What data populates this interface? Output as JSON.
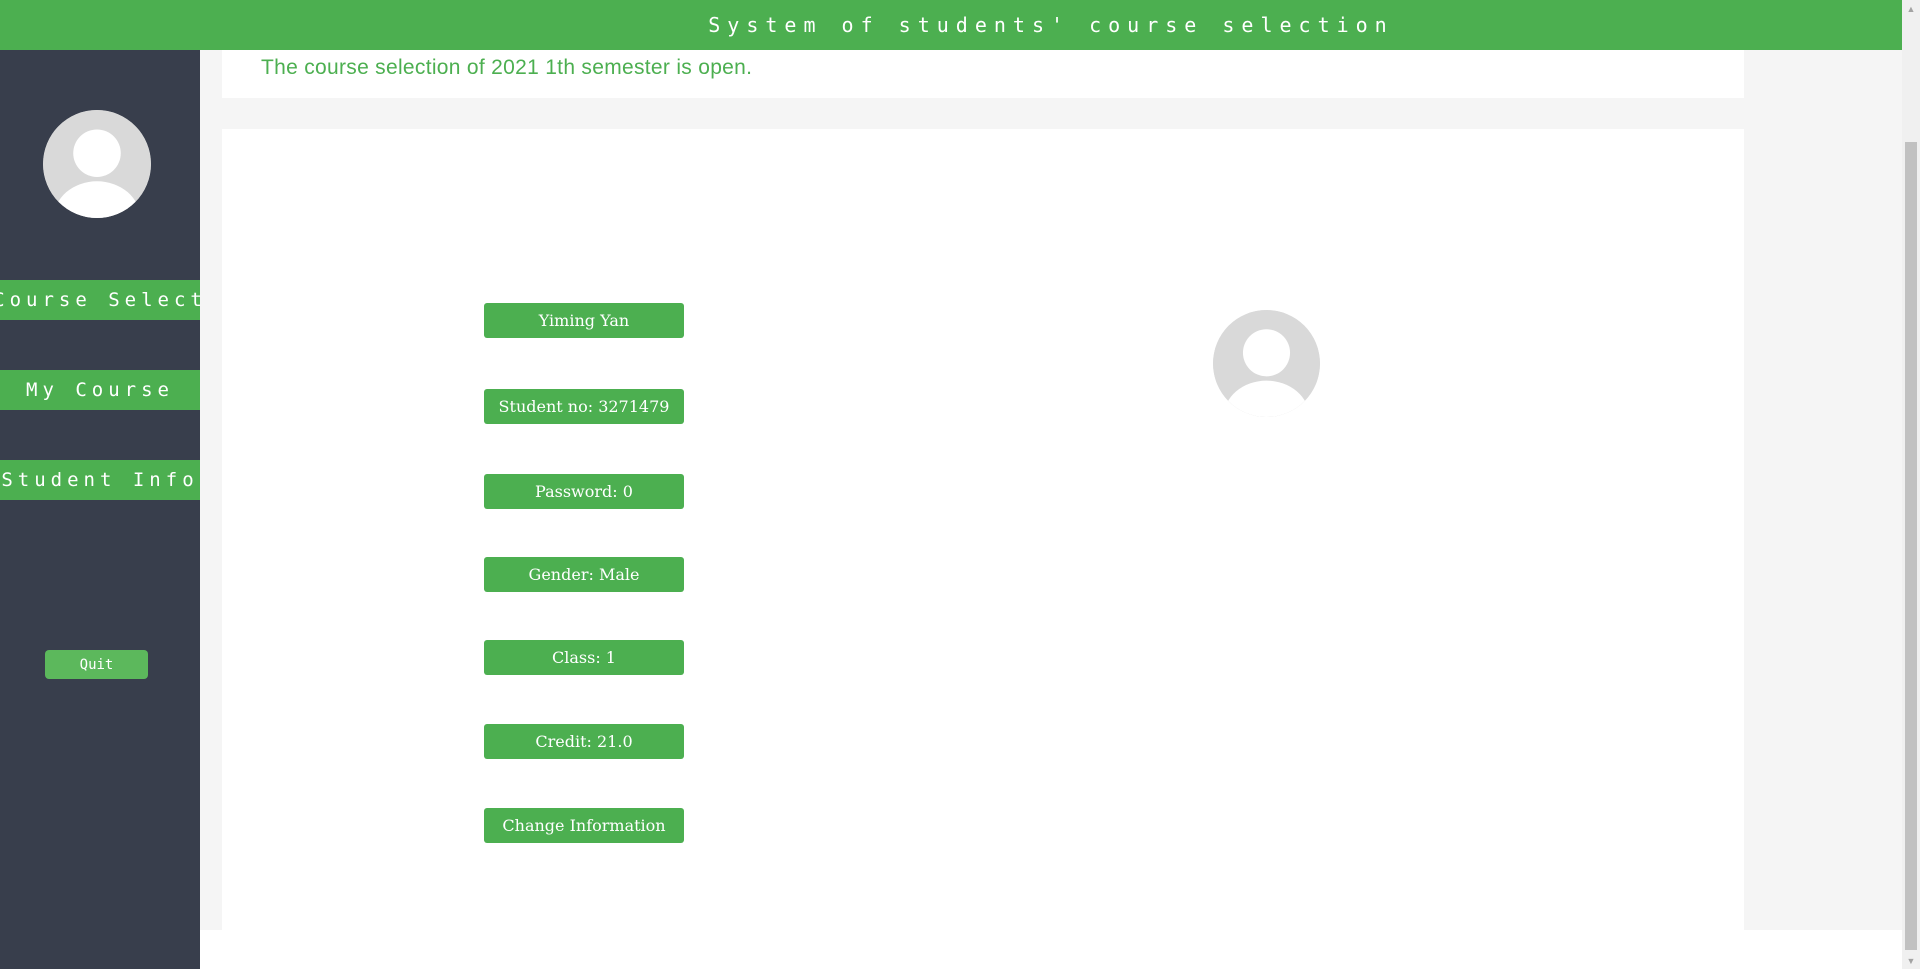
{
  "header": {
    "title": "System of students' course selection",
    "background": "#4caf50"
  },
  "sidebar": {
    "background": "#383e4c",
    "avatar_icon": "user-avatar-icon",
    "nav": [
      {
        "label": "Course Select"
      },
      {
        "label": "My Course"
      },
      {
        "label": "Student Info"
      }
    ],
    "quit_label": "Quit"
  },
  "notice": {
    "text": "The course selection of 2021 1th semester is open.",
    "color": "#4caf50"
  },
  "student_info": {
    "name": "Yiming Yan",
    "student_no": "Student no: 3271479",
    "password": "Password: 0",
    "gender": "Gender: Male",
    "class": "Class: 1",
    "credit": "Credit: 21.0",
    "change_button": "Change Information",
    "avatar_icon": "user-avatar-icon"
  },
  "scrollbar": {
    "up_icon": "caret-up-icon",
    "down_icon": "caret-down-icon"
  }
}
